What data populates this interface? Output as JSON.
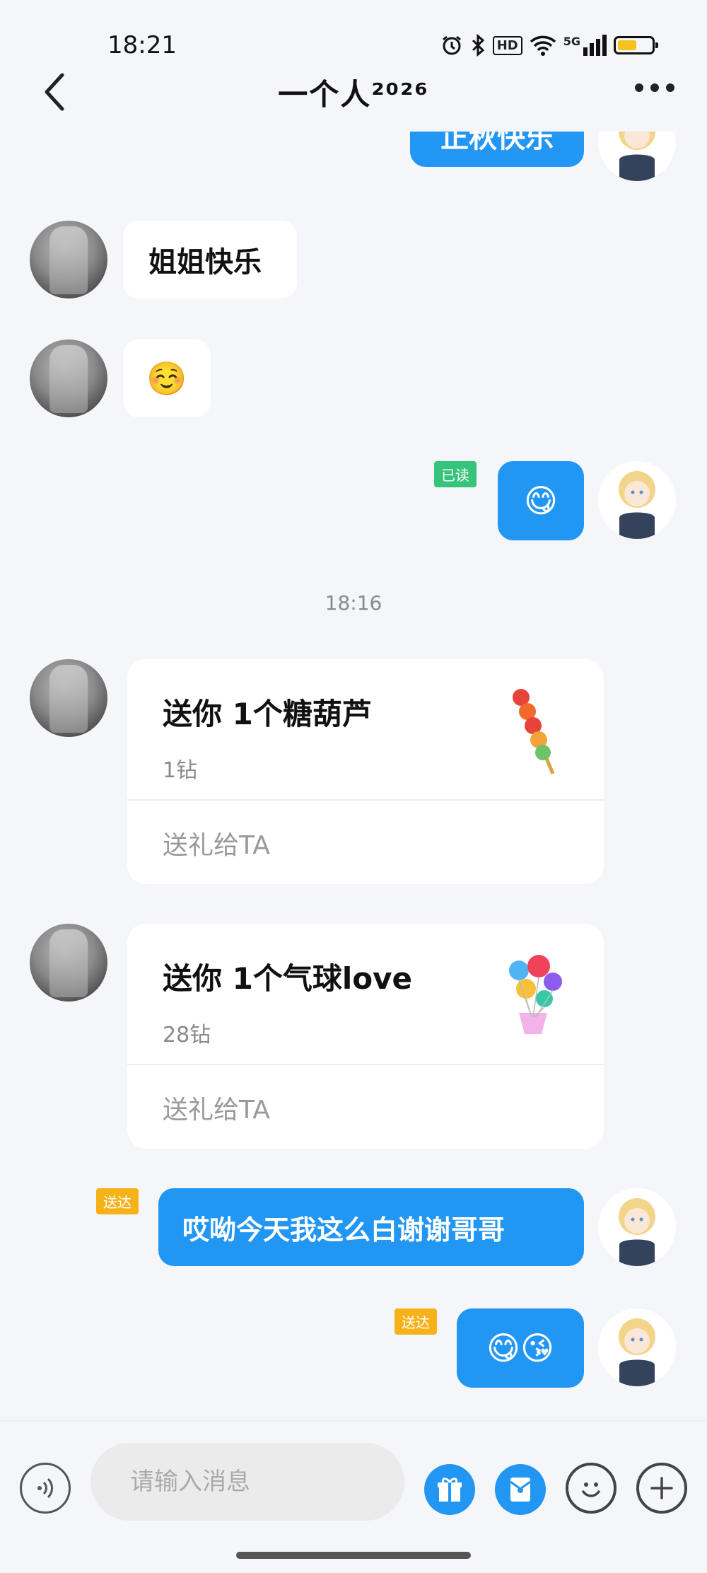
{
  "status_bar": {
    "time": "18:21",
    "icons": [
      "alarm-icon",
      "bluetooth-icon",
      "hd-icon",
      "wifi-icon",
      "signal-5g-icon",
      "battery-icon"
    ],
    "hd_label": "HD",
    "net_label": "5G"
  },
  "header": {
    "title": "一个人²⁰²⁶",
    "back_icon": "chevron-left-icon",
    "more_icon": "more-dots-icon"
  },
  "messages": [
    {
      "side": "right",
      "text": "正秋快乐",
      "partial": true
    },
    {
      "side": "left",
      "text": "姐姐快乐"
    },
    {
      "side": "left",
      "emoji": "☺️"
    },
    {
      "side": "right",
      "emoji": "😋",
      "status": "已读"
    },
    {
      "timestamp": "18:16"
    },
    {
      "side": "left",
      "type": "gift",
      "title": "送你 1个糖葫芦",
      "price": "1钻",
      "action": "送礼给TA",
      "gift_icon": "candied-haws-icon"
    },
    {
      "side": "left",
      "type": "gift",
      "title": "送你 1个气球love",
      "price": "28钻",
      "action": "送礼给TA",
      "gift_icon": "balloon-love-icon"
    },
    {
      "side": "right",
      "text": "哎呦今天我这么白谢谢哥哥",
      "status": "送达"
    },
    {
      "side": "right",
      "emoji": "😋😘",
      "status": "送达"
    }
  ],
  "input_bar": {
    "placeholder": "请输入消息",
    "icons": [
      "voice-icon",
      "gift-icon",
      "red-packet-icon",
      "emoji-icon",
      "plus-icon"
    ]
  },
  "colors": {
    "accent_blue": "#2196f3",
    "read_green": "#36c37a",
    "delivered_orange": "#f7b21a",
    "background": "#f4f6f9"
  }
}
